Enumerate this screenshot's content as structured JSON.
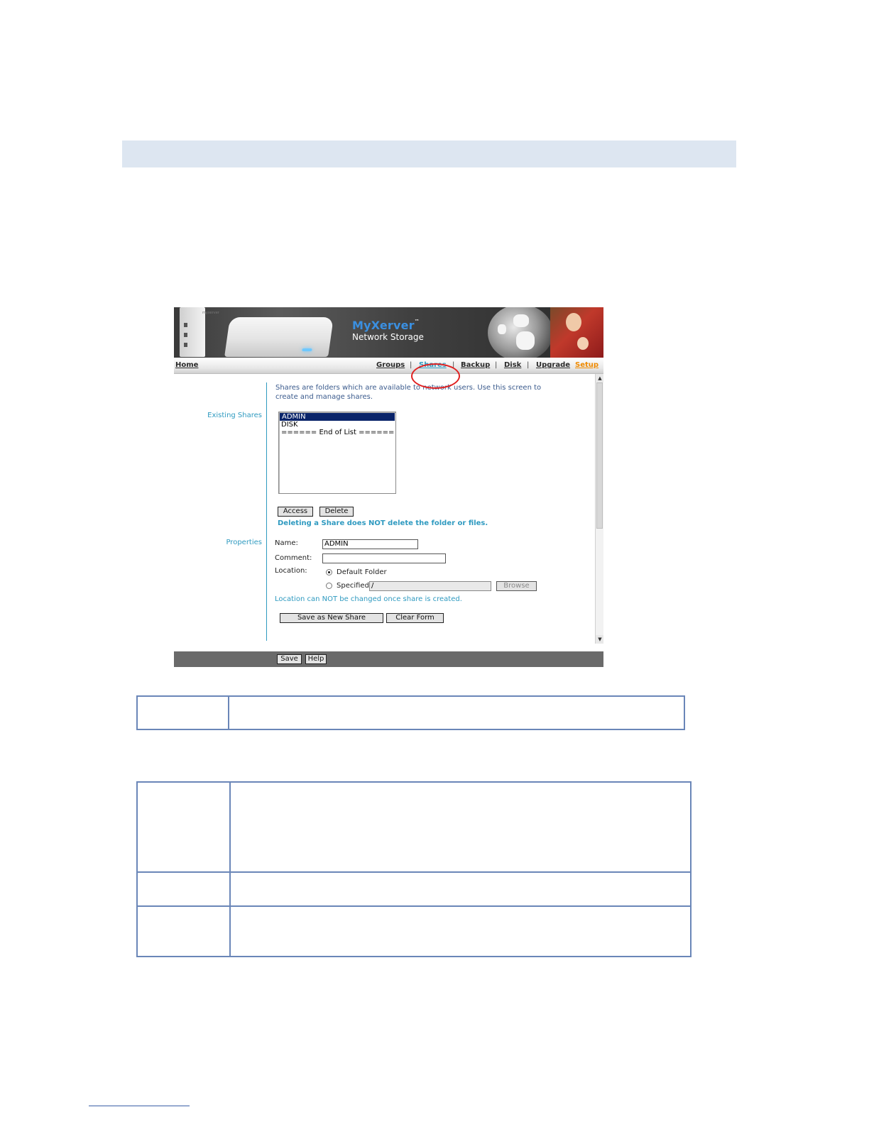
{
  "app": {
    "brand": "MyXerver",
    "brand_tm": "™",
    "brand_subtitle": "Network Storage",
    "device_label": "myxerver"
  },
  "nav": {
    "home": "Home",
    "items": [
      "Groups",
      "Shares",
      "Backup",
      "Disk",
      "Upgrade",
      "Setup"
    ],
    "separator": "|",
    "active": "Shares"
  },
  "shares": {
    "intro": "Shares are folders which are available to network users. Use this screen to create and manage shares.",
    "existing_label": "Existing Shares",
    "list": [
      "ADMIN",
      "DISK",
      "====== End of List ======"
    ],
    "selected": "ADMIN",
    "access_button": "Access",
    "delete_button": "Delete",
    "delete_note": "Deleting a Share does NOT delete the folder or files."
  },
  "properties": {
    "section_label": "Properties",
    "name_label": "Name:",
    "name_value": "ADMIN",
    "comment_label": "Comment:",
    "comment_value": "",
    "location_label": "Location:",
    "default_folder_label": "Default Folder",
    "specified_label": "Specified",
    "specified_value": "/",
    "browse_button": "Browse",
    "location_note": "Location can NOT be changed once share is created.",
    "save_new_button": "Save as New Share",
    "clear_button": "Clear Form"
  },
  "footer": {
    "save_button": "Save",
    "help_button": "Help"
  },
  "colors": {
    "accent": "#2f9ac0",
    "setup": "#ef8a00",
    "highlight": "#e02020",
    "table_border": "#6a86b8",
    "heading_band": "#dde6f1"
  }
}
